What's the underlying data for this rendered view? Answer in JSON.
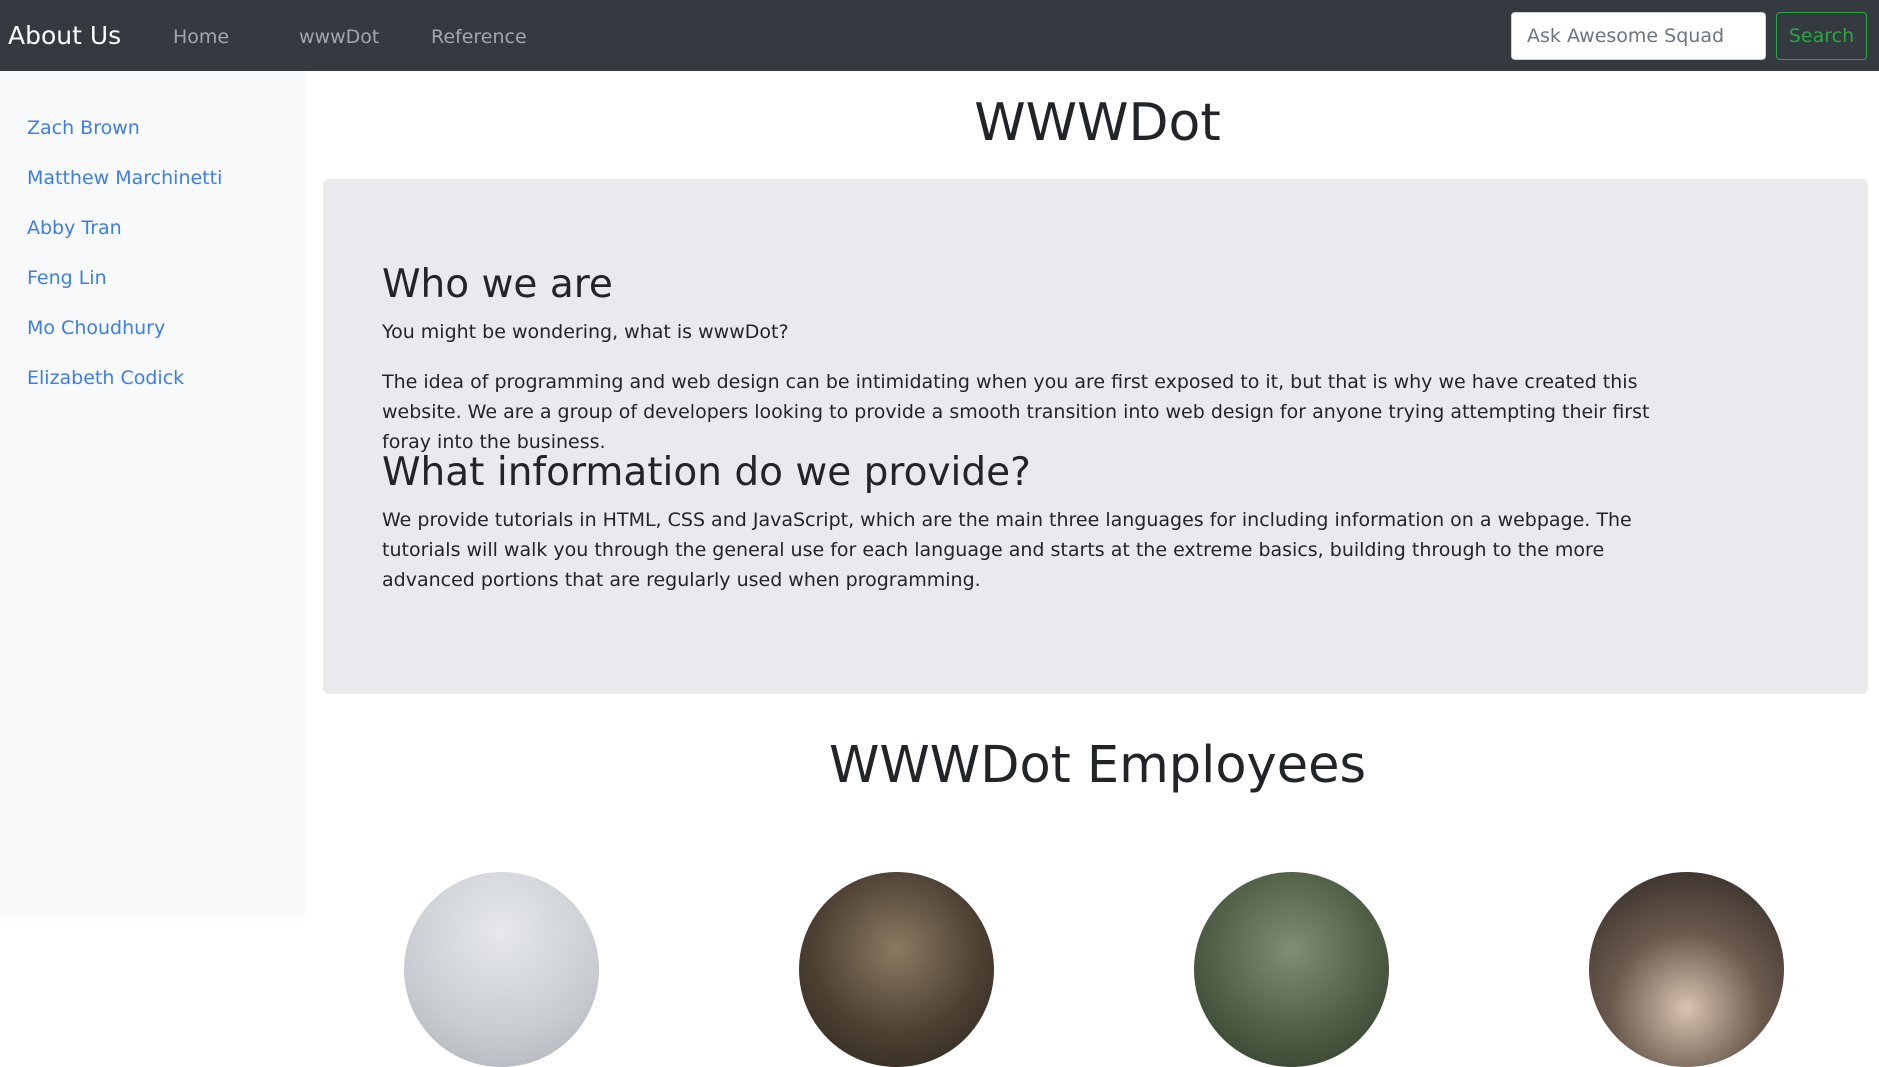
{
  "navbar": {
    "brand": "About Us",
    "links": [
      "Home",
      "wwwDot",
      "Reference"
    ],
    "search_placeholder": "Ask Awesome Squad",
    "search_button": "Search"
  },
  "sidebar": {
    "items": [
      {
        "label": "Zach Brown"
      },
      {
        "label": "Matthew Marchinetti"
      },
      {
        "label": "Abby Tran"
      },
      {
        "label": "Feng Lin"
      },
      {
        "label": "Mo Choudhury"
      },
      {
        "label": "Elizabeth Codick"
      }
    ]
  },
  "main": {
    "title": "WWWDot",
    "who_heading": "Who we are",
    "who_intro": "You might be wondering, what is wwwDot?",
    "who_body": "The idea of programming and web design can be intimidating when you are first exposed to it, but that is why we have created this website. We are a group of developers looking to provide a smooth transition into web design for anyone trying attempting their first foray into the business.",
    "info_heading": "What information do we provide?",
    "info_body": "We provide tutorials in HTML, CSS and JavaScript, which are the main three languages for including information on a webpage. The tutorials will walk you through the general use for each language and starts at the extreme basics, building through to the more advanced portions that are regularly used when programming.",
    "employees_heading": "WWWDot Employees"
  },
  "colors": {
    "navbar_bg": "#343a40",
    "link_blue": "#3f7ee0",
    "search_green": "#28a745",
    "jumbotron_bg": "#e9eaed"
  }
}
